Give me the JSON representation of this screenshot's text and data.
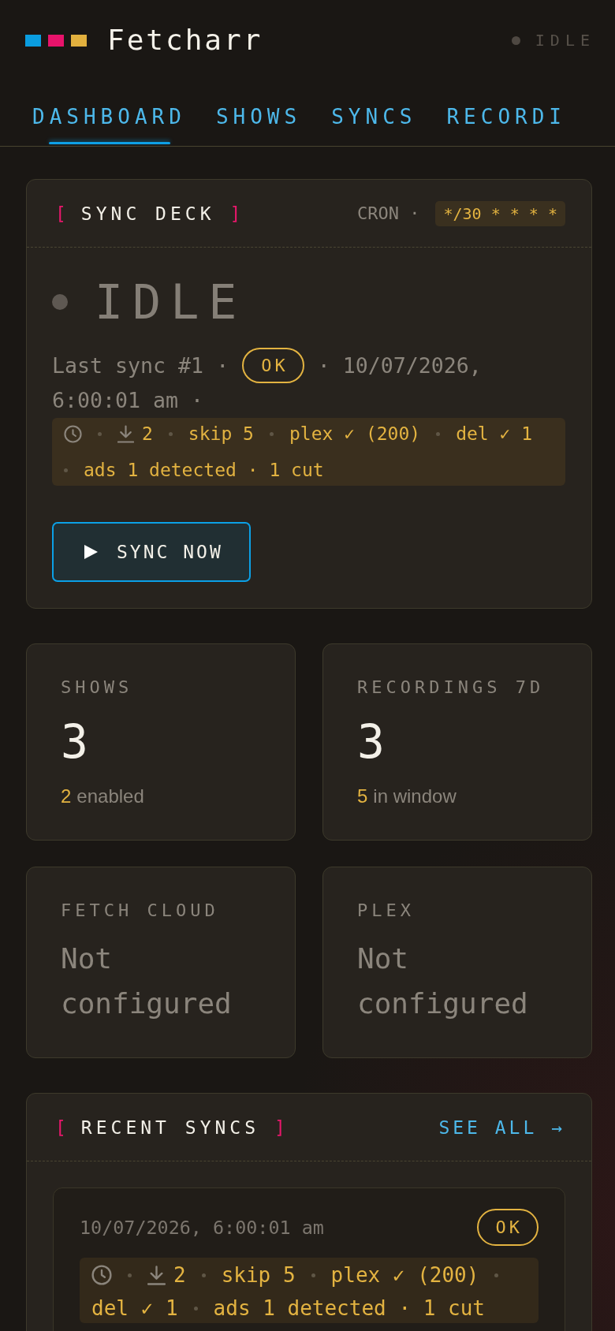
{
  "header": {
    "title": "Fetcharr",
    "status": "IDLE"
  },
  "tabs": [
    {
      "label": "DASHBOARD",
      "selected": true
    },
    {
      "label": "SHOWS",
      "selected": false
    },
    {
      "label": "SYNCS",
      "selected": false
    },
    {
      "label": "RECORDI",
      "selected": false
    }
  ],
  "sync_deck": {
    "bracket_open": "[",
    "title": "SYNC DECK",
    "bracket_close": "]",
    "cron_label": "CRON ·",
    "cron": "*/30 * * * *",
    "state": "IDLE",
    "last_sync_label": "Last sync #1 ·",
    "last_sync_status": "OK",
    "last_sync_date": "· 10/07/2026,",
    "last_sync_clock": "6:00:01 am ·",
    "summary": {
      "downloads": "2",
      "items": [
        "skip 5",
        "plex ✓ (200)",
        "del ✓ 1",
        "ads 1 detected · 1 cut"
      ]
    },
    "button": "SYNC NOW"
  },
  "stats": [
    {
      "kind": "count",
      "label": "SHOWS",
      "value": "3",
      "detail_count": "2",
      "detail": "enabled"
    },
    {
      "kind": "count",
      "label": "RECORDINGS 7D",
      "value": "3",
      "detail_count": "5",
      "detail": "in window"
    },
    {
      "kind": "service",
      "label": "FETCH CLOUD",
      "value": "Not configured"
    },
    {
      "kind": "service",
      "label": "PLEX",
      "value": "Not configured"
    }
  ],
  "recent_syncs": {
    "bracket_open": "[",
    "title": "RECENT SYNCS",
    "bracket_close": "]",
    "link": "SEE ALL →",
    "items": [
      {
        "time": "10/07/2026, 6:00:01 am",
        "status": "OK",
        "summary": {
          "downloads": "2",
          "items": [
            "skip 5",
            "plex ✓ (200)",
            "del ✓ 1",
            "ads 1 detected · 1 cut"
          ]
        }
      }
    ]
  }
}
